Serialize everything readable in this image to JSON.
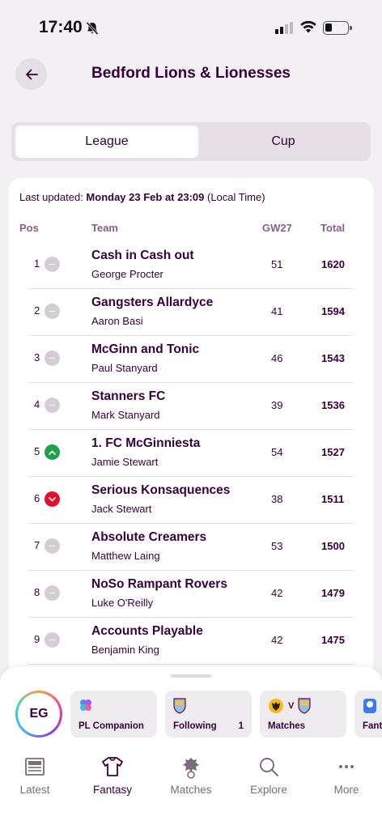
{
  "status_bar": {
    "time": "17:40"
  },
  "header": {
    "title": "Bedford Lions & Lionesses"
  },
  "segments": {
    "league": "League",
    "cup": "Cup"
  },
  "updated": {
    "prefix": "Last updated:",
    "datetime": "Monday 23 Feb at 23:09",
    "suffix": "(Local Time)"
  },
  "table": {
    "headers": {
      "pos": "Pos",
      "team": "Team",
      "gw": "GW27",
      "total": "Total"
    },
    "rows": [
      {
        "pos": "1",
        "movement": "same",
        "team": "Cash in Cash out",
        "manager": "George Procter",
        "gw": "51",
        "total": "1620"
      },
      {
        "pos": "2",
        "movement": "same",
        "team": "Gangsters Allardyce",
        "manager": "Aaron Basi",
        "gw": "41",
        "total": "1594"
      },
      {
        "pos": "3",
        "movement": "same",
        "team": "McGinn and Tonic",
        "manager": "Paul Stanyard",
        "gw": "46",
        "total": "1543"
      },
      {
        "pos": "4",
        "movement": "same",
        "team": "Stanners FC",
        "manager": "Mark Stanyard",
        "gw": "39",
        "total": "1536"
      },
      {
        "pos": "5",
        "movement": "up",
        "team": "1. FC McGinniesta",
        "manager": "Jamie Stewart",
        "gw": "54",
        "total": "1527"
      },
      {
        "pos": "6",
        "movement": "down",
        "team": "Serious Konsaquences",
        "manager": "Jack Stewart",
        "gw": "38",
        "total": "1511"
      },
      {
        "pos": "7",
        "movement": "same",
        "team": "Absolute Creamers",
        "manager": "Matthew Laing",
        "gw": "53",
        "total": "1500"
      },
      {
        "pos": "8",
        "movement": "same",
        "team": "NoSo Rampant Rovers",
        "manager": "Luke O'Reilly",
        "gw": "42",
        "total": "1479"
      },
      {
        "pos": "9",
        "movement": "same",
        "team": "Accounts Playable",
        "manager": "Benjamin King",
        "gw": "42",
        "total": "1475"
      }
    ]
  },
  "quick_access": {
    "avatar_initials": "EG",
    "chips": [
      {
        "label": "PL Companion",
        "icon": "sparkle-icon"
      },
      {
        "label": "Following",
        "count": "1",
        "icon": "aston-villa-crest-icon"
      },
      {
        "label": "Matches",
        "vs": "V",
        "icon": "wolves-vs-villa-icon"
      },
      {
        "label": "Fant",
        "icon": "premier-league-lion-icon"
      }
    ]
  },
  "tab_bar": [
    {
      "label": "Latest",
      "icon": "newspaper-icon"
    },
    {
      "label": "Fantasy",
      "icon": "shirt-icon",
      "active": true
    },
    {
      "label": "Matches",
      "icon": "premier-league-lion-icon"
    },
    {
      "label": "Explore",
      "icon": "search-icon"
    },
    {
      "label": "More",
      "icon": "more-dots-icon"
    }
  ],
  "colors": {
    "primary": "#37003c",
    "up": "#1fa14a",
    "down": "#e0102f",
    "background": "#f2f0f2"
  }
}
